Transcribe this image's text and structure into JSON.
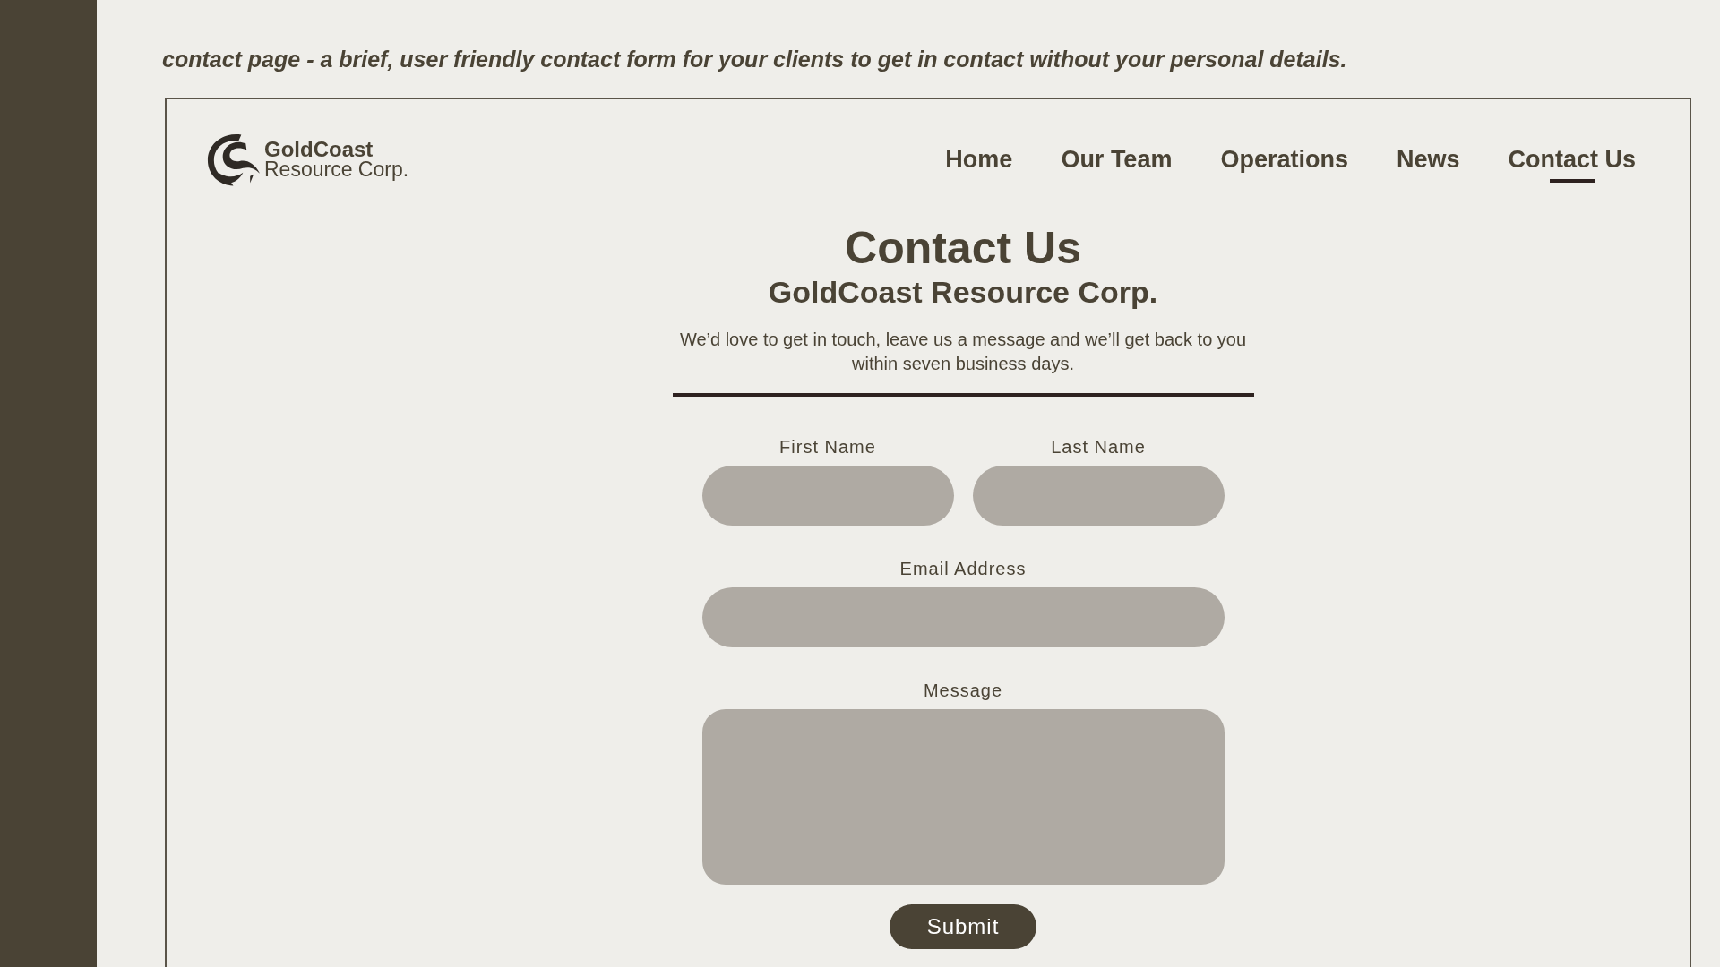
{
  "caption": "contact page - a brief, user friendly contact form for your clients to get in contact without your personal details.",
  "header": {
    "logo": {
      "name": "GoldCoast",
      "tagline": "Resource Corp."
    },
    "nav": [
      {
        "label": "Home",
        "selected": false
      },
      {
        "label": "Our Team",
        "selected": false
      },
      {
        "label": "Operations",
        "selected": false
      },
      {
        "label": "News",
        "selected": false
      },
      {
        "label": "Contact Us",
        "selected": true
      }
    ]
  },
  "contact": {
    "title": "Contact Us",
    "subtitle": "GoldCoast Resource Corp.",
    "intro": "We’d love to get in touch, leave us a message and we’ll get back to you within seven business days.",
    "rows": [
      [
        {
          "kind": "text",
          "label": "First Name"
        },
        {
          "kind": "text",
          "label": "Last Name"
        }
      ],
      [
        {
          "kind": "email",
          "label": "Email Address"
        }
      ],
      [
        {
          "kind": "textarea",
          "label": "Message"
        }
      ]
    ],
    "submit": "Submit"
  }
}
